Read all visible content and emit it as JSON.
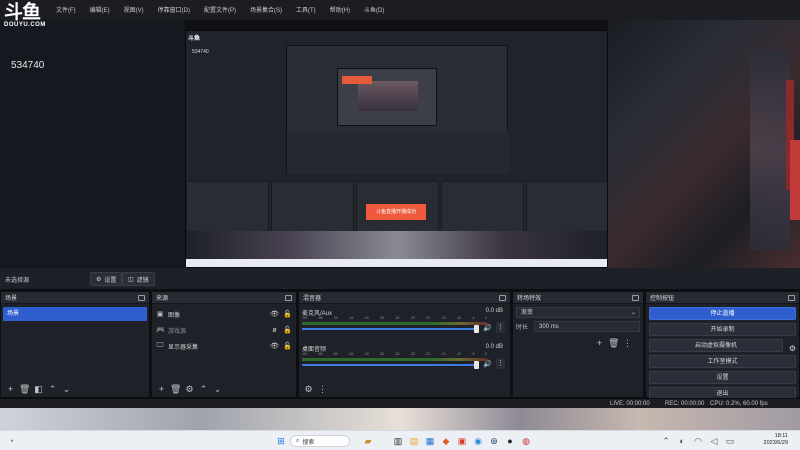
{
  "app": {
    "logo_mark": "斗鱼",
    "logo_sub": "DOUYU.COM",
    "viewer_count": "534740"
  },
  "menu": [
    "文件(F)",
    "编辑(E)",
    "视图(V)",
    "停靠窗口(D)",
    "配置文件(P)",
    "场景集合(S)",
    "工具(T)",
    "帮助(H)",
    "斗鱼(D)"
  ],
  "preview": {
    "title": "斗鱼",
    "count": "534740",
    "overlay_text": "斗鱼直播开播成功"
  },
  "toolbar": {
    "source_status": "未选择源",
    "properties_label": "设置",
    "filters_label": "滤镜"
  },
  "scenes": {
    "title": "场景",
    "items": [
      "场景"
    ]
  },
  "sources": {
    "title": "来源",
    "items": [
      {
        "name": "图像",
        "icon": "image-icon",
        "visible": true
      },
      {
        "name": "游戏源",
        "icon": "gamepad-icon",
        "visible": false
      },
      {
        "name": "显示器采集",
        "icon": "monitor-icon",
        "visible": true
      }
    ]
  },
  "mixer": {
    "title": "混音器",
    "tracks": [
      {
        "name": "麦克风/Aux",
        "db": "0.0 dB"
      },
      {
        "name": "桌面音频",
        "db": "0.0 dB"
      }
    ],
    "scale": [
      "-60",
      "-55",
      "-50",
      "-45",
      "-40",
      "-35",
      "-30",
      "-25",
      "-20",
      "-15",
      "-10",
      "-5",
      "0"
    ]
  },
  "transitions": {
    "title": "转场特效",
    "current": "渐变",
    "duration_label": "时长",
    "duration_value": "300 ms"
  },
  "controls": {
    "title": "控制按钮",
    "buttons": [
      "停止直播",
      "开始录制",
      "启动虚拟摄像机",
      "工作室模式",
      "设置",
      "退出"
    ]
  },
  "status": {
    "live": "LIVE: 00:00:00",
    "rec": "REC: 00:00:00",
    "cpu": "CPU: 0.2%, 60.00 fps"
  },
  "taskbar": {
    "search_placeholder": "搜索",
    "time": "18:11",
    "date": "2023/6/29"
  },
  "colors": {
    "accent": "#2f5fcf",
    "live_orange": "#ef5a3c",
    "panel": "#1f2128"
  }
}
